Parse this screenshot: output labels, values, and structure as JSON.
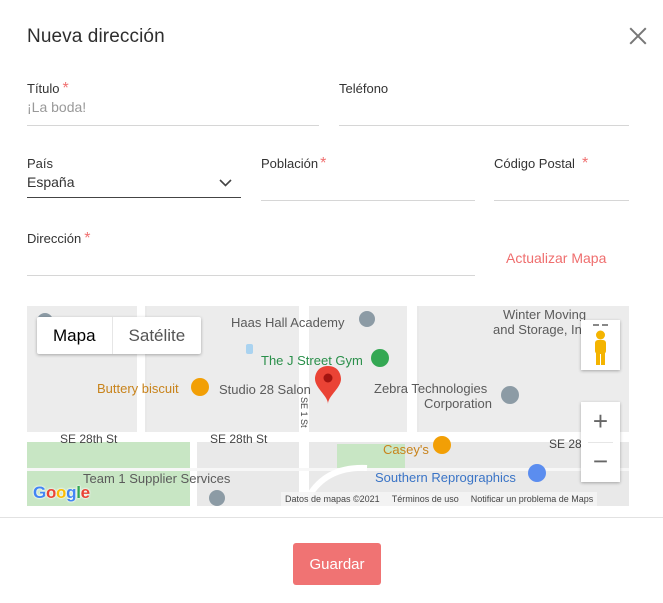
{
  "dialog": {
    "title": "Nueva dirección"
  },
  "form": {
    "titulo": {
      "label": "Título",
      "required": "*",
      "placeholder": "¡La boda!"
    },
    "telefono": {
      "label": "Teléfono",
      "value": ""
    },
    "pais": {
      "label": "País",
      "value": "España"
    },
    "poblacion": {
      "label": "Población",
      "required": "*",
      "value": ""
    },
    "codigo_postal": {
      "label": "Código Postal",
      "required": "*",
      "value": ""
    },
    "direccion": {
      "label": "Dirección",
      "required": "*",
      "value": ""
    },
    "update_map_label": "Actualizar Mapa"
  },
  "map": {
    "type_options": [
      "Mapa",
      "Satélite"
    ],
    "selected_type": "Mapa",
    "places": {
      "haas": "Haas Hall Academy",
      "gym": "The J Street Gym",
      "buttery": "Buttery biscuit",
      "studio": "Studio 28 Salon",
      "zebra_1": "Zebra Technologies",
      "zebra_2": "Corporation",
      "winter_1": "Winter Moving",
      "winter_2": "and Storage, In",
      "caseys": "Casey's",
      "southern": "Southern Reprographics",
      "team": "Team 1 Supplier Services"
    },
    "roads": {
      "se28_left": "SE 28th St",
      "se28_mid": "SE 28th St",
      "se28_right": "SE 28",
      "se1": "SE 1 St"
    },
    "zoom_in": "+",
    "zoom_out": "−",
    "logo": "Google",
    "attribution": [
      "Datos de mapas ©2021",
      "Términos de uso",
      "Notificar un problema de Maps"
    ]
  },
  "footer": {
    "save_label": "Guardar"
  },
  "colors": {
    "accent": "#f07373",
    "required": "#f07070",
    "map_background": "#e9e9e9",
    "map_green": "#c8e6c4"
  }
}
